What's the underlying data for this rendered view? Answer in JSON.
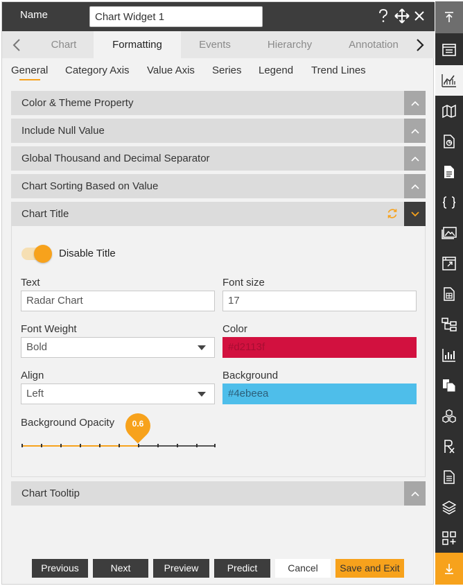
{
  "header": {
    "name_label": "Name",
    "widget_name": "Chart Widget 1",
    "icons": [
      "help-icon",
      "move-icon",
      "close-icon"
    ]
  },
  "tabs": {
    "items": [
      "Chart",
      "Formatting",
      "Events",
      "Hierarchy",
      "Annotation"
    ],
    "active": "Formatting"
  },
  "subtabs": {
    "items": [
      "General",
      "Category Axis",
      "Value Axis",
      "Series",
      "Legend",
      "Trend Lines"
    ],
    "active": "General"
  },
  "sections": {
    "color_theme": "Color & Theme Property",
    "null_value": "Include Null Value",
    "separator": "Global Thousand and Decimal Separator",
    "sorting": "Chart Sorting Based on Value",
    "chart_title": "Chart Title",
    "tooltip": "Chart Tooltip"
  },
  "chart_title_form": {
    "toggle_label": "Disable Title",
    "toggle_on": true,
    "text_label": "Text",
    "text_value": "Radar Chart",
    "font_size_label": "Font size",
    "font_size_value": "17",
    "font_weight_label": "Font Weight",
    "font_weight_value": "Bold",
    "color_label": "Color",
    "color_value": "#d2113f",
    "align_label": "Align",
    "align_value": "Left",
    "background_label": "Background",
    "background_value": "#4ebeea",
    "opacity_label": "Background Opacity",
    "opacity_value": "0.6"
  },
  "footer": {
    "previous": "Previous",
    "next": "Next",
    "preview": "Preview",
    "predict": "Predict",
    "cancel": "Cancel",
    "save_exit": "Save and Exit"
  },
  "colors": {
    "accent": "#f7a21c",
    "header_bg": "#3d3d3d",
    "title_color": "#d2113f",
    "title_background": "#4ebeea"
  },
  "rail_icons": [
    "scroll-top-icon",
    "dashboard-icon",
    "chart-icon",
    "map-icon",
    "report-icon",
    "document-icon",
    "code-icon",
    "image-icon",
    "calendar-widget-icon",
    "data-sheet-icon",
    "hierarchy-icon",
    "bar-chart-icon",
    "copy-icon",
    "cubes-icon",
    "formula-icon",
    "notes-icon",
    "layers-icon",
    "add-widget-icon",
    "scroll-bottom-icon"
  ]
}
